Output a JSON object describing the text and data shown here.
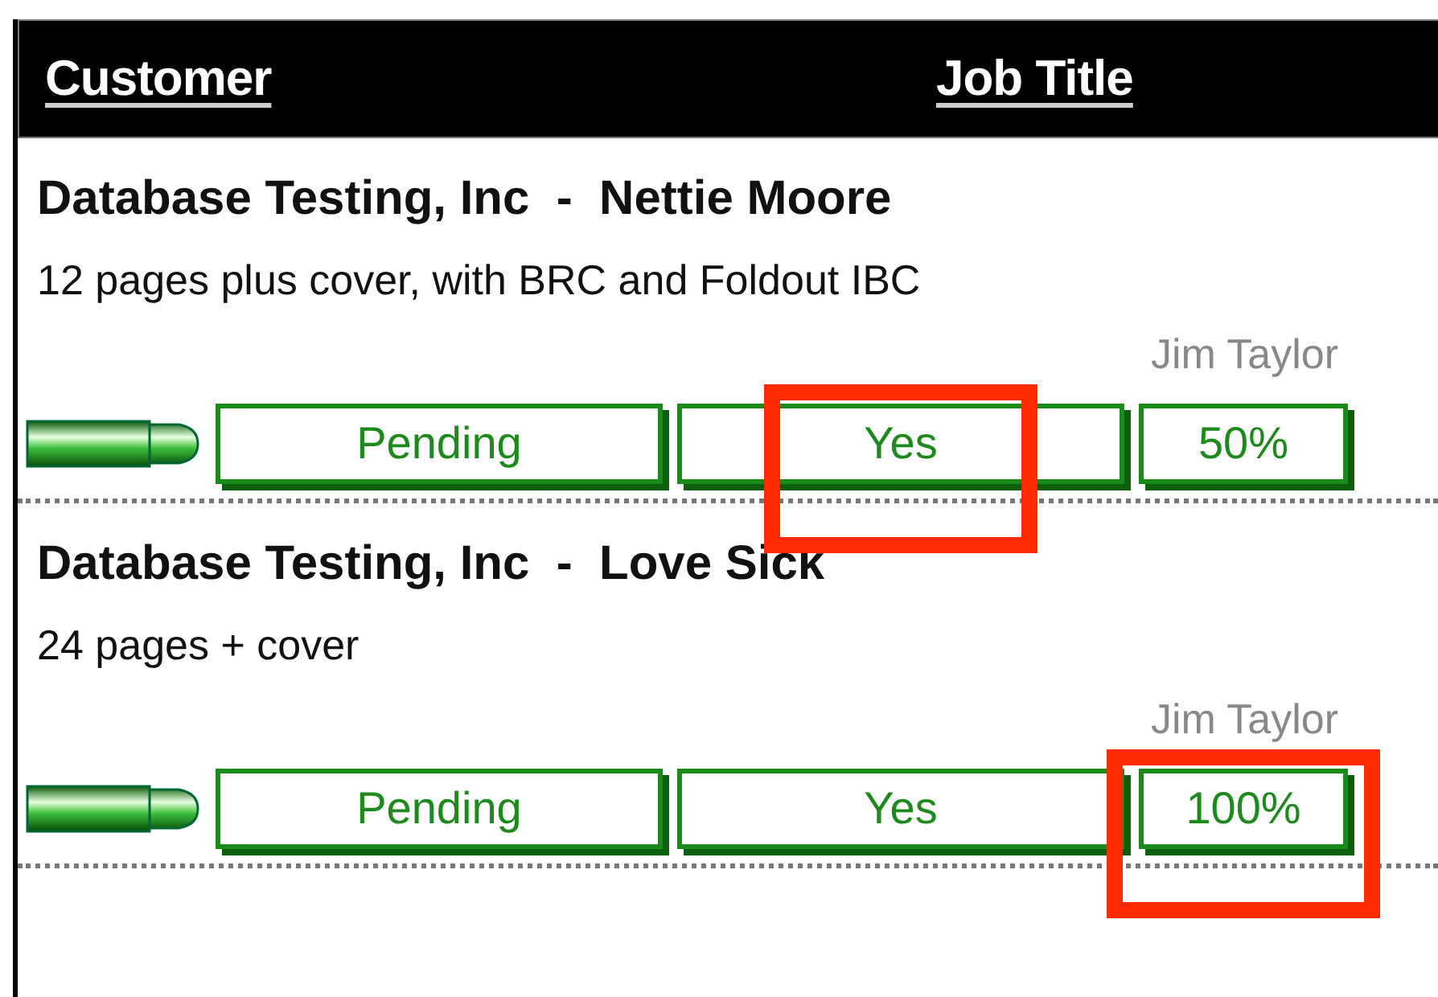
{
  "table": {
    "columns": [
      {
        "label": "Customer"
      },
      {
        "label": "Job Title"
      }
    ],
    "rows": [
      {
        "title": "Database Testing, Inc  -  Nettie Moore",
        "description": "12 pages plus cover, with BRC and Foldout IBC",
        "assignee": "Jim Taylor",
        "statuses": [
          {
            "text": "Pending",
            "highlighted": false
          },
          {
            "text": "Yes",
            "highlighted": true
          },
          {
            "text": "50%",
            "highlighted": false
          }
        ]
      },
      {
        "title": "Database Testing, Inc  -  Love Sick",
        "description": "24 pages + cover",
        "assignee": "Jim Taylor",
        "statuses": [
          {
            "text": "Pending",
            "highlighted": false
          },
          {
            "text": "Yes",
            "highlighted": false
          },
          {
            "text": "100%",
            "highlighted": true
          }
        ]
      }
    ]
  }
}
